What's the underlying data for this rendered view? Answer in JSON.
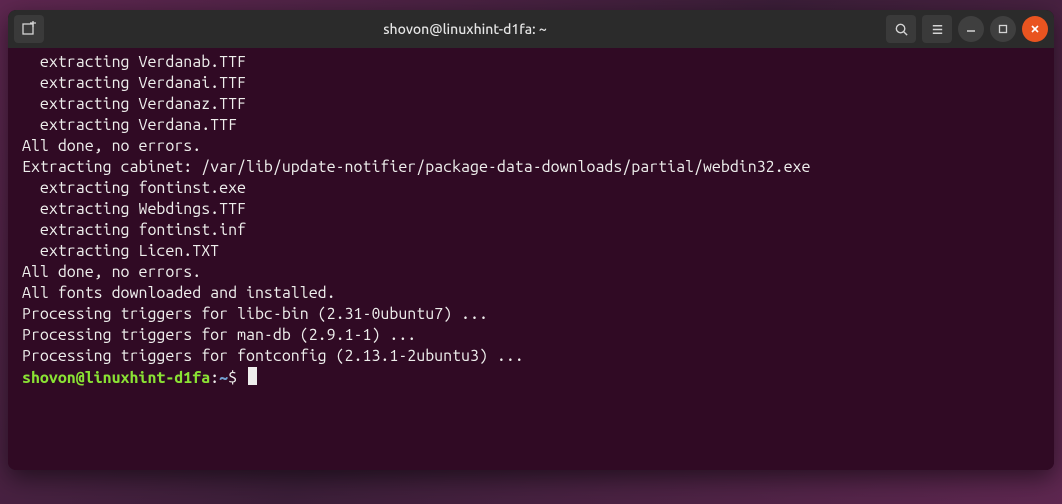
{
  "window": {
    "title": "shovon@linuxhint-d1fa: ~"
  },
  "terminal": {
    "lines": [
      "  extracting Verdanab.TTF",
      "  extracting Verdanai.TTF",
      "  extracting Verdanaz.TTF",
      "  extracting Verdana.TTF",
      "",
      "All done, no errors.",
      "Extracting cabinet: /var/lib/update-notifier/package-data-downloads/partial/webdin32.exe",
      "  extracting fontinst.exe",
      "  extracting Webdings.TTF",
      "  extracting fontinst.inf",
      "  extracting Licen.TXT",
      "",
      "All done, no errors.",
      "All fonts downloaded and installed.",
      "Processing triggers for libc-bin (2.31-0ubuntu7) ...",
      "Processing triggers for man-db (2.9.1-1) ...",
      "Processing triggers for fontconfig (2.13.1-2ubuntu3) ..."
    ],
    "prompt": {
      "user_host": "shovon@linuxhint-d1fa",
      "separator": ":",
      "path": "~",
      "symbol": "$"
    }
  },
  "icons": {
    "new_tab": "new-tab-icon",
    "search": "search-icon",
    "menu": "menu-icon",
    "minimize": "minimize-icon",
    "maximize": "maximize-icon",
    "close": "close-icon"
  }
}
